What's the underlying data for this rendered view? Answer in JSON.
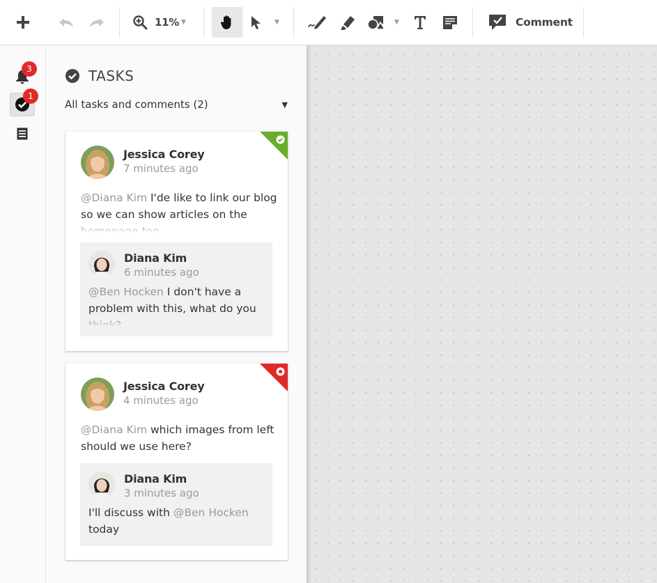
{
  "toolbar": {
    "zoom_value": "11%",
    "comment_label": "Comment"
  },
  "rail": {
    "notifications_count": "3",
    "tasks_count": "1"
  },
  "panel": {
    "title": "TASKS",
    "filter_label": "All tasks and comments (2)"
  },
  "cards": [
    {
      "status": "done",
      "status_color": "#6aac2b",
      "author": "Jessica Corey",
      "time": "7 minutes ago",
      "mention": "@Diana Kim",
      "text": " I'de like to link our blog so we can show articles on the homepage too",
      "reply": {
        "author": "Diana Kim",
        "time": "6 minutes ago",
        "mention": "@Ben Hocken",
        "text": " I don't have a problem with this, what do you think?"
      }
    },
    {
      "status": "open",
      "status_color": "#e02a2a",
      "author": "Jessica Corey",
      "time": "4 minutes ago",
      "mention": "@Diana Kim",
      "text": " which images from left should we use here?",
      "reply": {
        "author": "Diana Kim",
        "time": "3 minutes ago",
        "prefix": "I'll discuss with ",
        "mention": "@Ben Hocken",
        "suffix": " today"
      }
    }
  ],
  "icons": {
    "add": "plus-icon",
    "undo": "undo-icon",
    "redo": "redo-icon",
    "zoom": "zoom-in-icon",
    "hand": "hand-icon",
    "pointer": "pointer-icon",
    "pen": "pen-icon",
    "marker": "marker-icon",
    "shapes": "shapes-icon",
    "text": "text-icon",
    "note": "note-icon",
    "comment": "comment-icon",
    "bell": "bell-icon",
    "check": "check-circle-icon",
    "list": "list-icon"
  }
}
